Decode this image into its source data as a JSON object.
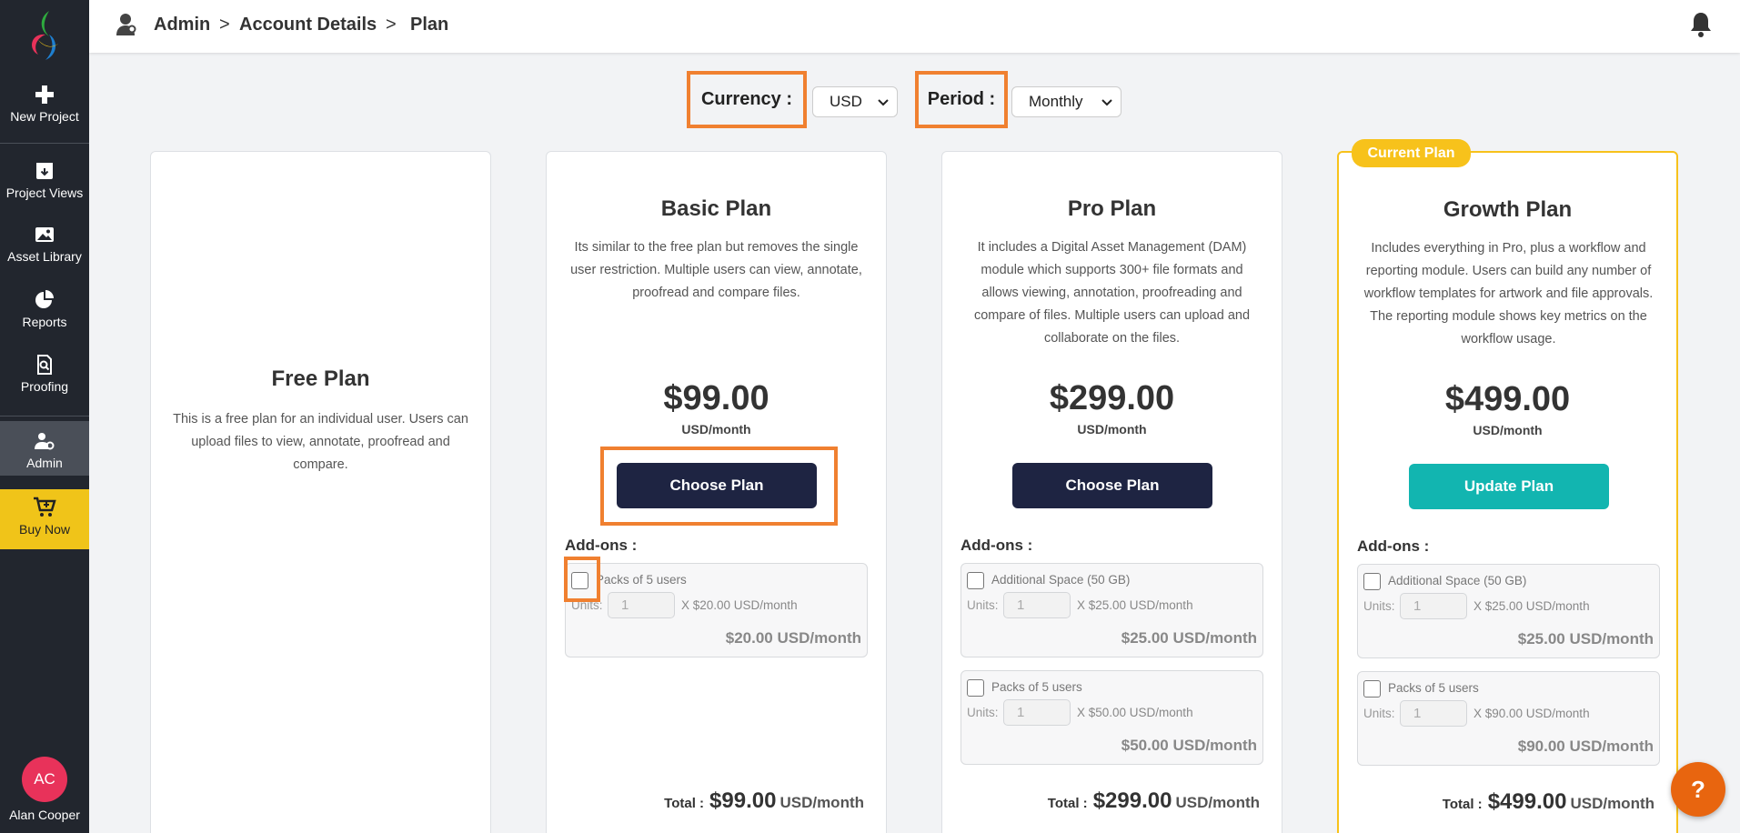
{
  "sidebar": {
    "items": [
      {
        "label": "New Project",
        "icon": "plus-icon"
      },
      {
        "label": "Project Views",
        "icon": "download-box-icon"
      },
      {
        "label": "Asset Library",
        "icon": "image-icon"
      },
      {
        "label": "Reports",
        "icon": "pie-chart-icon"
      },
      {
        "label": "Proofing",
        "icon": "document-search-icon"
      },
      {
        "label": "Admin",
        "icon": "user-settings-icon"
      }
    ],
    "buy_now": "Buy Now",
    "user": {
      "initials": "AC",
      "name": "Alan Cooper"
    }
  },
  "breadcrumb": {
    "items": [
      "Admin",
      "Account Details",
      "Plan"
    ],
    "separator": ">"
  },
  "controls": {
    "currency_label": "Currency :",
    "currency_value": "USD",
    "period_label": "Period :",
    "period_value": "Monthly"
  },
  "plans": [
    {
      "title": "Free Plan",
      "description": "This is a free plan for an individual user. Users can upload files to view, annotate, proofread and compare."
    },
    {
      "title": "Basic Plan",
      "description": "Its similar to the free plan but removes the single user restriction. Multiple users can view, annotate, proofread and compare files.",
      "price": "$99.00",
      "price_unit": "USD/month",
      "button": "Choose Plan",
      "addons_title": "Add-ons :",
      "addons": [
        {
          "name": "Packs of 5 users",
          "units_label": "Units:",
          "units": "1",
          "rate": "X $20.00 USD/month",
          "amount": "$20.00 USD/month"
        }
      ],
      "total_label": "Total :",
      "total_value": "$99.00",
      "total_unit": "USD/month"
    },
    {
      "title": "Pro Plan",
      "description": "It includes a Digital Asset Management (DAM) module which supports 300+ file formats and allows viewing, annotation, proofreading and compare of files. Multiple users can upload and collaborate on the files.",
      "price": "$299.00",
      "price_unit": "USD/month",
      "button": "Choose Plan",
      "addons_title": "Add-ons :",
      "addons": [
        {
          "name": "Additional Space (50 GB)",
          "units_label": "Units:",
          "units": "1",
          "rate": "X $25.00 USD/month",
          "amount": "$25.00 USD/month"
        },
        {
          "name": "Packs of 5 users",
          "units_label": "Units:",
          "units": "1",
          "rate": "X $50.00 USD/month",
          "amount": "$50.00 USD/month"
        }
      ],
      "total_label": "Total :",
      "total_value": "$299.00",
      "total_unit": "USD/month"
    },
    {
      "badge": "Current Plan",
      "title": "Growth Plan",
      "description": "Includes everything in Pro, plus a workflow and reporting module. Users can build any number of workflow templates for artwork and file approvals. The reporting module shows key metrics on the workflow usage.",
      "price": "$499.00",
      "price_unit": "USD/month",
      "button": "Update Plan",
      "addons_title": "Add-ons :",
      "addons": [
        {
          "name": "Additional Space (50 GB)",
          "units_label": "Units:",
          "units": "1",
          "rate": "X $25.00 USD/month",
          "amount": "$25.00 USD/month"
        },
        {
          "name": "Packs of 5 users",
          "units_label": "Units:",
          "units": "1",
          "rate": "X $90.00 USD/month",
          "amount": "$90.00 USD/month"
        }
      ],
      "total_label": "Total :",
      "total_value": "$499.00",
      "total_unit": "USD/month"
    }
  ],
  "help": "?",
  "colors": {
    "sidebar": "#22262e",
    "buy_now": "#f0c419",
    "button_dark": "#1e2442",
    "button_teal": "#12b5b0",
    "current_plan": "#f7c21b",
    "highlight": "#f08030",
    "avatar": "#e8325a",
    "help": "#e8650f"
  }
}
